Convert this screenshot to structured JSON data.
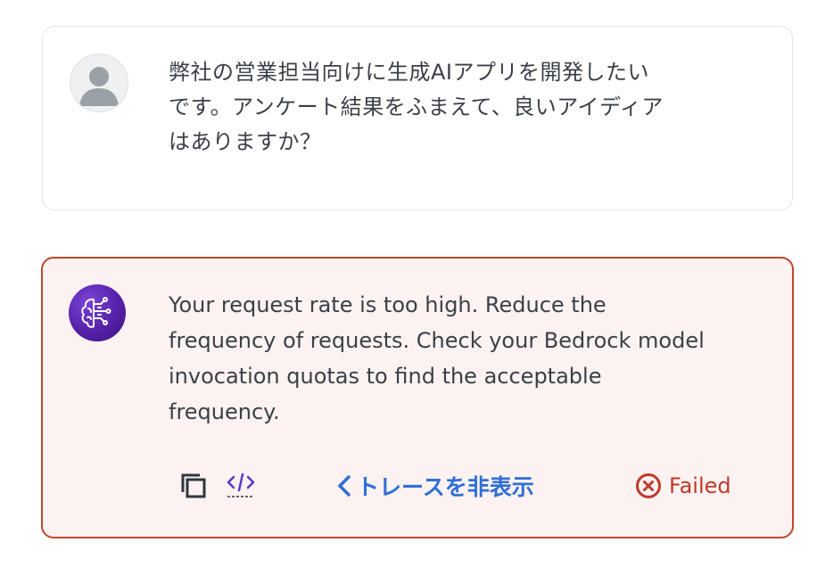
{
  "user_message": {
    "avatar_icon": "user-avatar-icon",
    "lines": [
      "弊社の営業担当向けに生成AIアプリを開発したい",
      "です。アンケート結果をふまえて、良いアイディア",
      "はありますか？"
    ]
  },
  "assistant_message": {
    "avatar_icon": "brain-circuit-icon",
    "lines": [
      "Your request rate is too high. Reduce the",
      "frequency of requests. Check your Bedrock model",
      "invocation quotas to find the acceptable",
      "frequency."
    ],
    "actions": {
      "copy_icon": "copy-icon",
      "code_icon": "code-icon",
      "trace_label": "トレースを非表示",
      "trace_icon": "chevron-left-icon"
    },
    "status": {
      "label": "Failed",
      "icon": "error-x-circle-icon",
      "color": "#c0392b"
    }
  },
  "colors": {
    "error_border": "#c0472b",
    "error_background": "#fbf2f1",
    "link": "#2f6fd6",
    "bot_avatar": "#5521a8"
  }
}
